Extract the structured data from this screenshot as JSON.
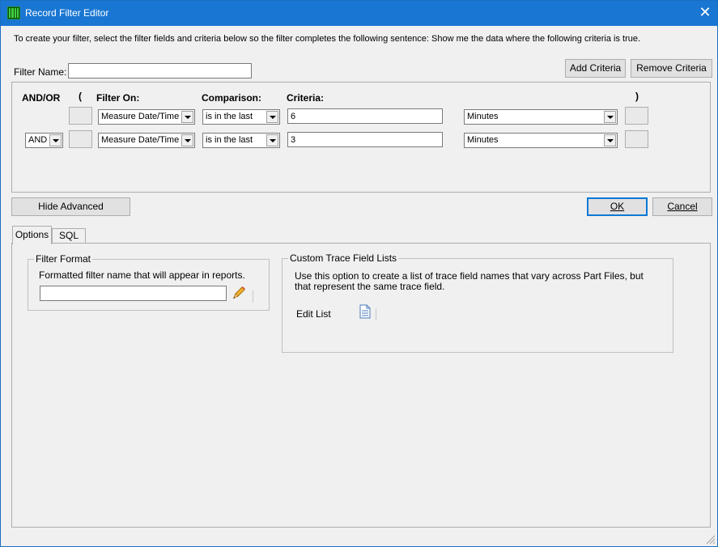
{
  "window": {
    "title": "Record Filter Editor",
    "close_glyph": "✕"
  },
  "instructions": "To create your filter, select the filter fields and criteria below so the filter completes the following sentence: Show me the data where the following criteria is true.",
  "filter_name": {
    "label": "Filter Name:",
    "value": ""
  },
  "buttons": {
    "add_criteria": "Add Criteria",
    "remove_criteria": "Remove Criteria",
    "hide_advanced": "Hide Advanced",
    "ok": "OK",
    "cancel": "Cancel"
  },
  "criteria_headers": {
    "and_or": "AND/OR",
    "open_paren": "(",
    "filter_on": "Filter On:",
    "comparison": "Comparison:",
    "criteria": "Criteria:",
    "close_paren": ")"
  },
  "criteria_rows": [
    {
      "and_or": "",
      "filter_on": "Measure Date/Time",
      "comparison": "is in the last",
      "criteria": "6",
      "unit": "Minutes"
    },
    {
      "and_or": "AND",
      "filter_on": "Measure Date/Time",
      "comparison": "is in the last",
      "criteria": "3",
      "unit": "Minutes"
    }
  ],
  "tabs": [
    {
      "label": "Options",
      "active": true
    },
    {
      "label": "SQL",
      "active": false
    }
  ],
  "filter_format": {
    "legend": "Filter Format",
    "description": "Formatted filter name that will appear in reports.",
    "value": "",
    "icon": "pencil-icon"
  },
  "custom_trace": {
    "legend": "Custom Trace Field Lists",
    "description_line1": "Use this option to create a list of trace field names that vary across Part Files, but",
    "description_line2": "that represent the same trace field.",
    "edit_list_label": "Edit List",
    "icon": "document-icon"
  }
}
